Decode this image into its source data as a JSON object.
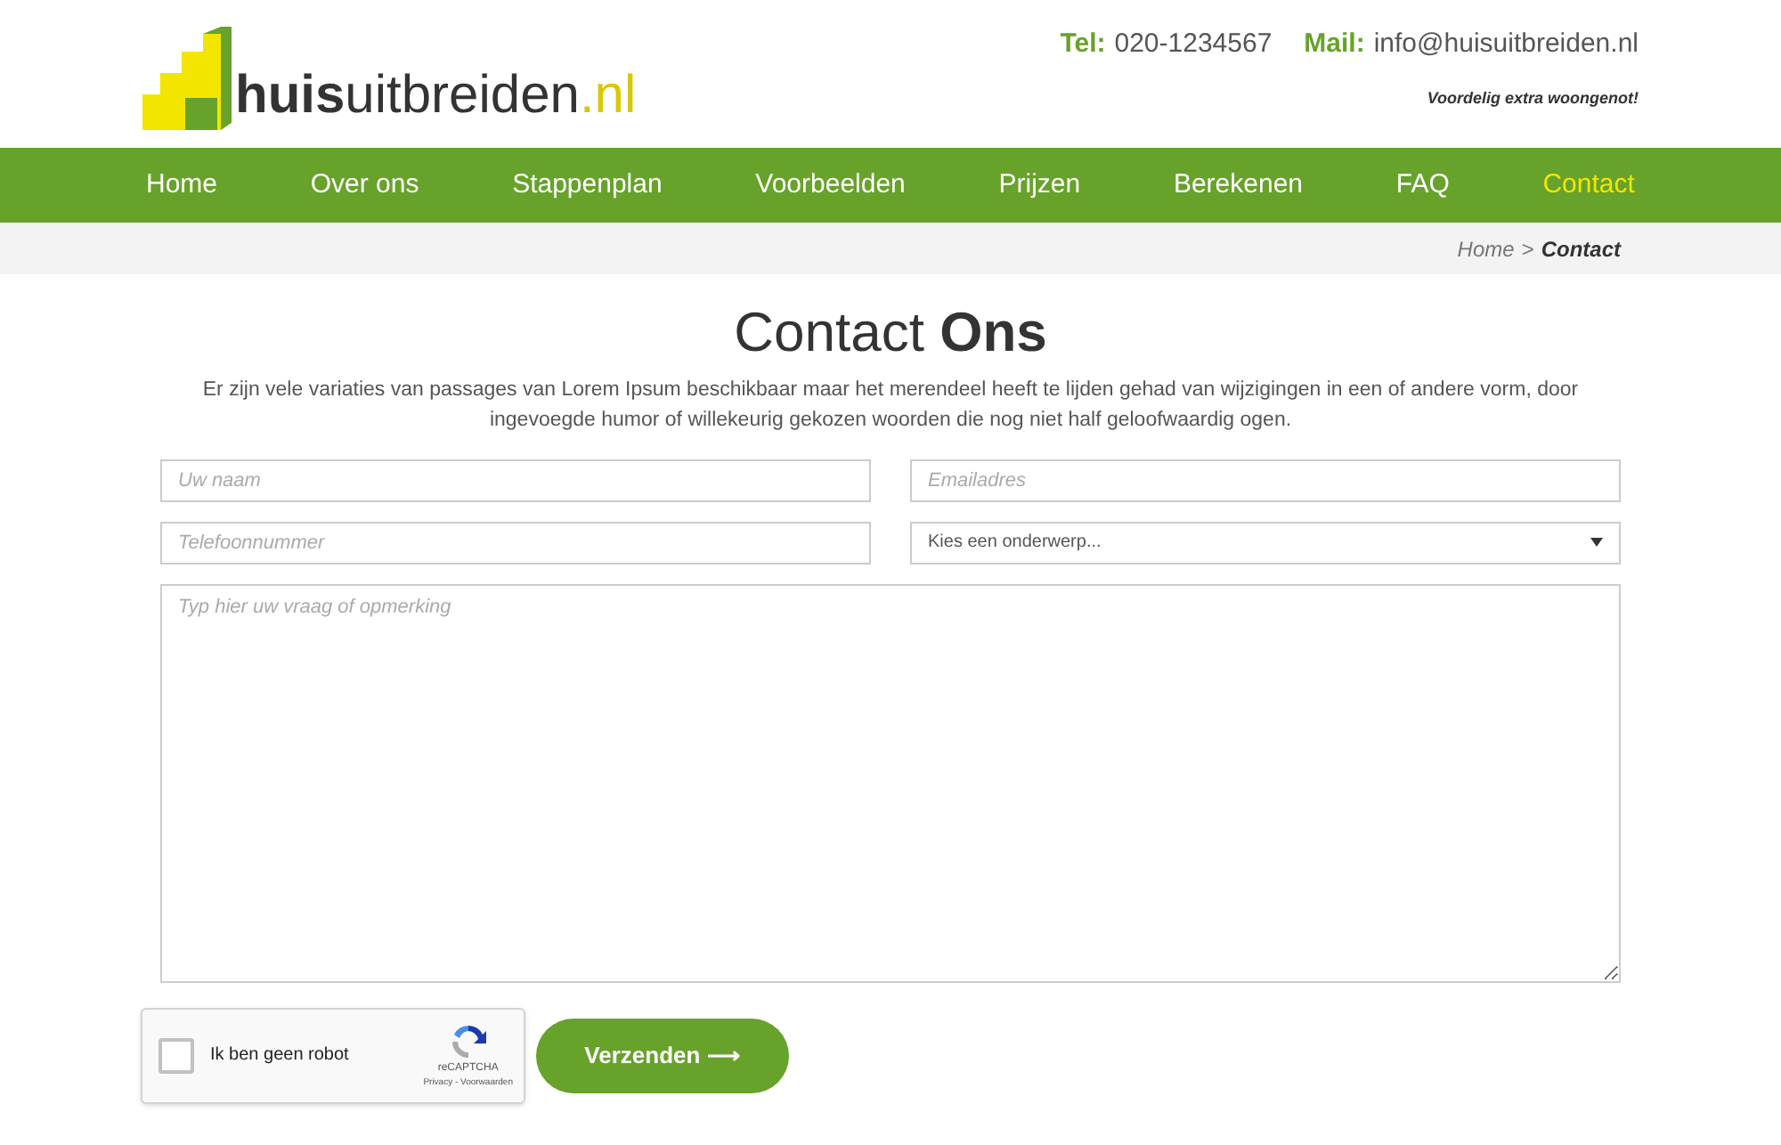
{
  "logo": {
    "name": "**huis**uitbreiden",
    "tld": ".nl"
  },
  "contact": {
    "tel_label": "Tel:",
    "tel": "020-1234567",
    "mail_label": "Mail:",
    "mail": "info@huisuitbreiden.nl",
    "tagline": "Voordelig extra woongenot!"
  },
  "nav": [
    {
      "label": "Home",
      "selected": false
    },
    {
      "label": "Over ons",
      "selected": false
    },
    {
      "label": "Stappenplan",
      "selected": false
    },
    {
      "label": "Voorbeelden",
      "selected": false
    },
    {
      "label": "Prijzen",
      "selected": false
    },
    {
      "label": "Berekenen",
      "selected": false
    },
    {
      "label": "FAQ",
      "selected": false
    },
    {
      "label": "Contact",
      "selected": true
    }
  ],
  "breadcrumb": {
    "home": "Home",
    "separator": ">",
    "current": "Contact"
  },
  "title": "Contact **Ons**",
  "intro": "Er zijn vele variaties van passages van Lorem Ipsum beschikbaar maar het merendeel heeft te lijden gehad van wijzigingen in een of andere vorm, door ingevoegde humor of willekeurig gekozen woorden die nog niet half geloofwaardig ogen.",
  "form": {
    "name": {
      "placeholder": "Uw naam"
    },
    "email": {
      "placeholder": "Emailadres"
    },
    "phone": {
      "placeholder": "Telefoonnummer"
    },
    "subject": {
      "value": "Kies een onderwerp..."
    },
    "message": {
      "placeholder": "Typ hier uw vraag of opmerking"
    }
  },
  "captcha": {
    "checked": false,
    "label": "Ik ben geen robot",
    "brand": "reCAPTCHA",
    "links": "Privacy - Voorwaarden"
  },
  "submit": "Verzenden ⟶"
}
